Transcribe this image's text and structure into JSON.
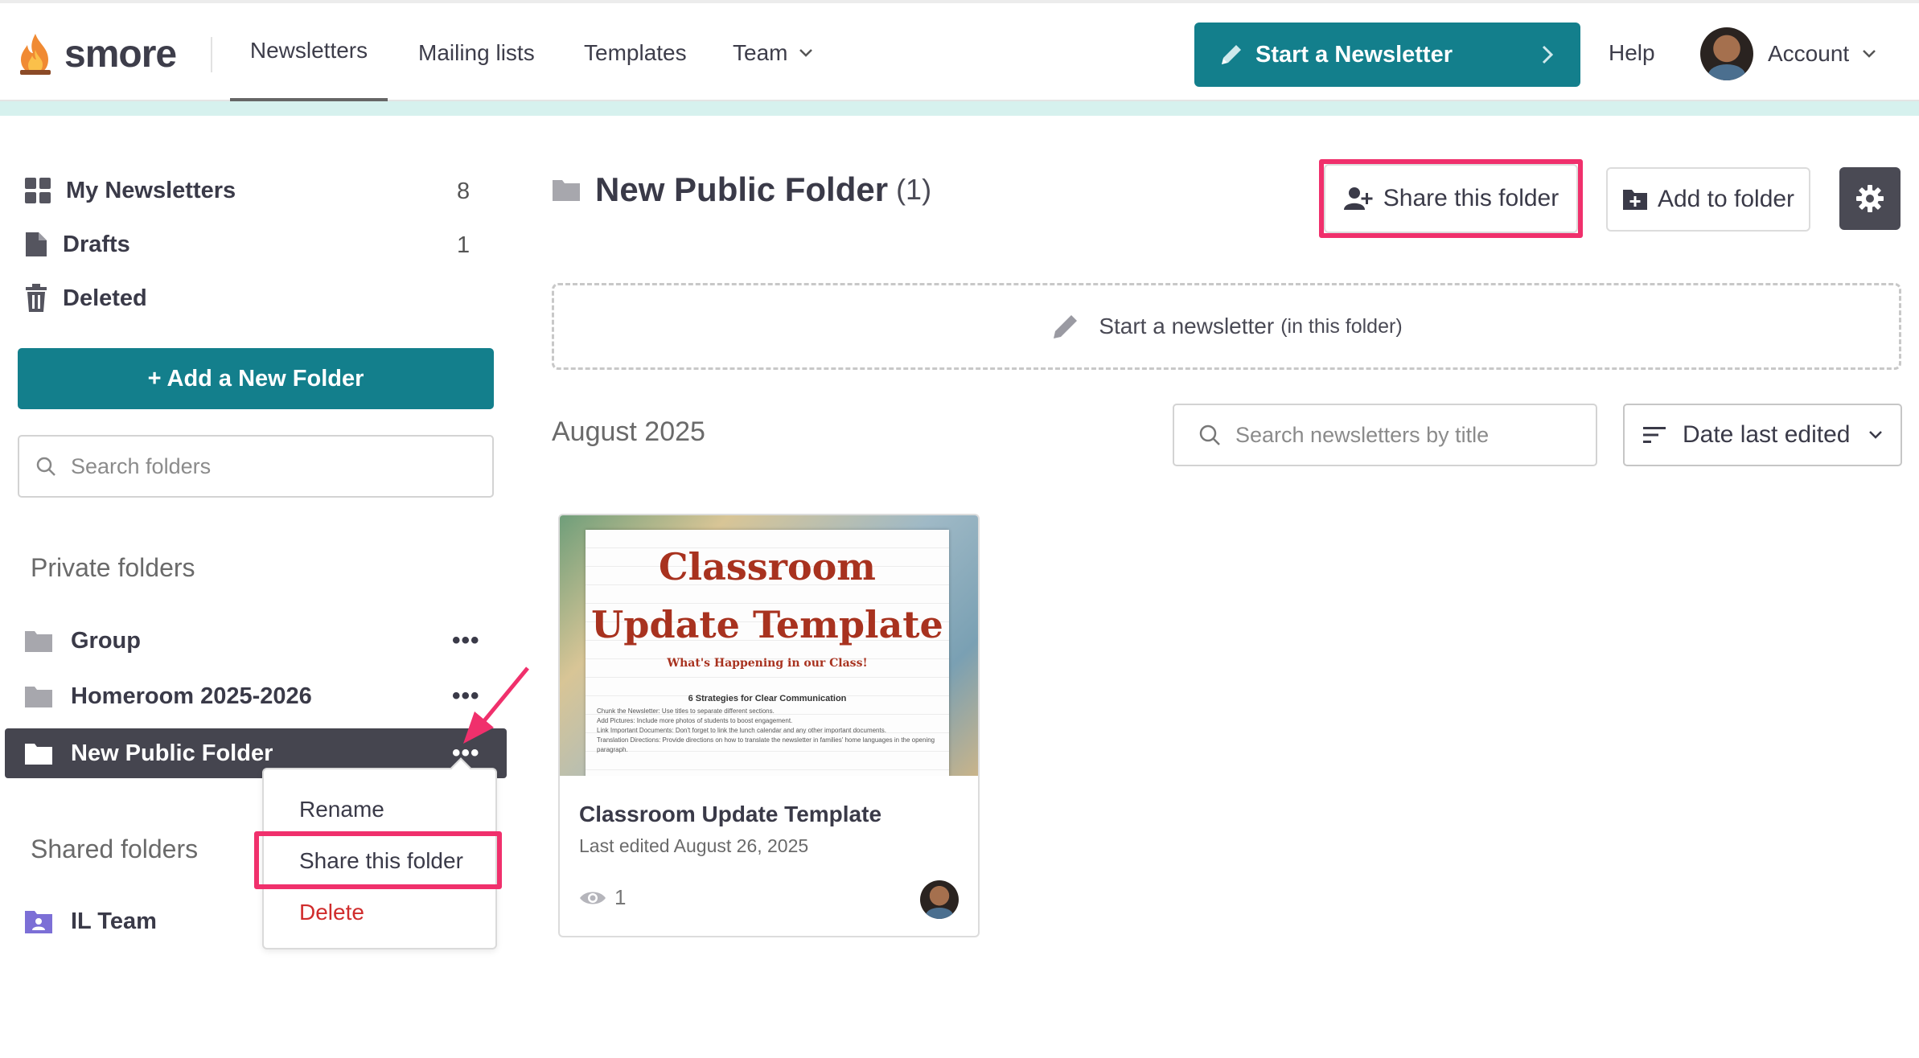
{
  "colors": {
    "accent": "#137f8c",
    "highlight": "#f0306c",
    "danger": "#d02c2c",
    "active_folder_bg": "#45454f"
  },
  "brand": {
    "name": "smore"
  },
  "nav": {
    "items": [
      {
        "label": "Newsletters"
      },
      {
        "label": "Mailing lists"
      },
      {
        "label": "Templates"
      },
      {
        "label": "Team"
      }
    ],
    "start_button": "Start a Newsletter",
    "help": "Help",
    "account": "Account"
  },
  "sidebar": {
    "items": [
      {
        "label": "My Newsletters",
        "count": "8",
        "icon": "grid-icon"
      },
      {
        "label": "Drafts",
        "count": "1",
        "icon": "document-icon"
      },
      {
        "label": "Deleted",
        "count": "",
        "icon": "trash-icon"
      }
    ],
    "add_folder": "+ Add a New Folder",
    "search_placeholder": "Search folders",
    "private_label": "Private folders",
    "private_folders": [
      {
        "label": "Group"
      },
      {
        "label": "Homeroom 2025-2026"
      },
      {
        "label": "New Public Folder",
        "active": true
      }
    ],
    "shared_label": "Shared folders",
    "shared_folders": [
      {
        "label": "IL Team"
      }
    ],
    "more_glyph": "•••"
  },
  "context_menu": {
    "items": [
      {
        "label": "Rename"
      },
      {
        "label": "Share this folder"
      },
      {
        "label": "Delete"
      }
    ]
  },
  "main": {
    "folder_name": "New Public Folder",
    "folder_count": "(1)",
    "share_button": "Share this folder",
    "add_to_folder": "Add to folder",
    "start_in_folder": "Start a newsletter",
    "start_in_folder_sub": "(in this folder)",
    "month": "August 2025",
    "search_placeholder": "Search newsletters by title",
    "sort_label": "Date last edited"
  },
  "card": {
    "title": "Classroom Update Template",
    "last_edited": "Last edited August 26, 2025",
    "views": "1",
    "thumb": {
      "title_line1": "Classroom",
      "title_line2": "Update Template",
      "tagline": "What's Happening in our Class!",
      "heading": "6 Strategies for Clear Communication",
      "lines": [
        "Chunk the Newsletter: Use titles to separate different sections.",
        "Add Pictures: Include more photos of students to boost engagement.",
        "Link Important Documents: Don't forget to link the lunch calendar and any other important documents.",
        "Translation Directions: Provide directions on how to translate the newsletter in families' home languages in the opening paragraph."
      ]
    }
  }
}
